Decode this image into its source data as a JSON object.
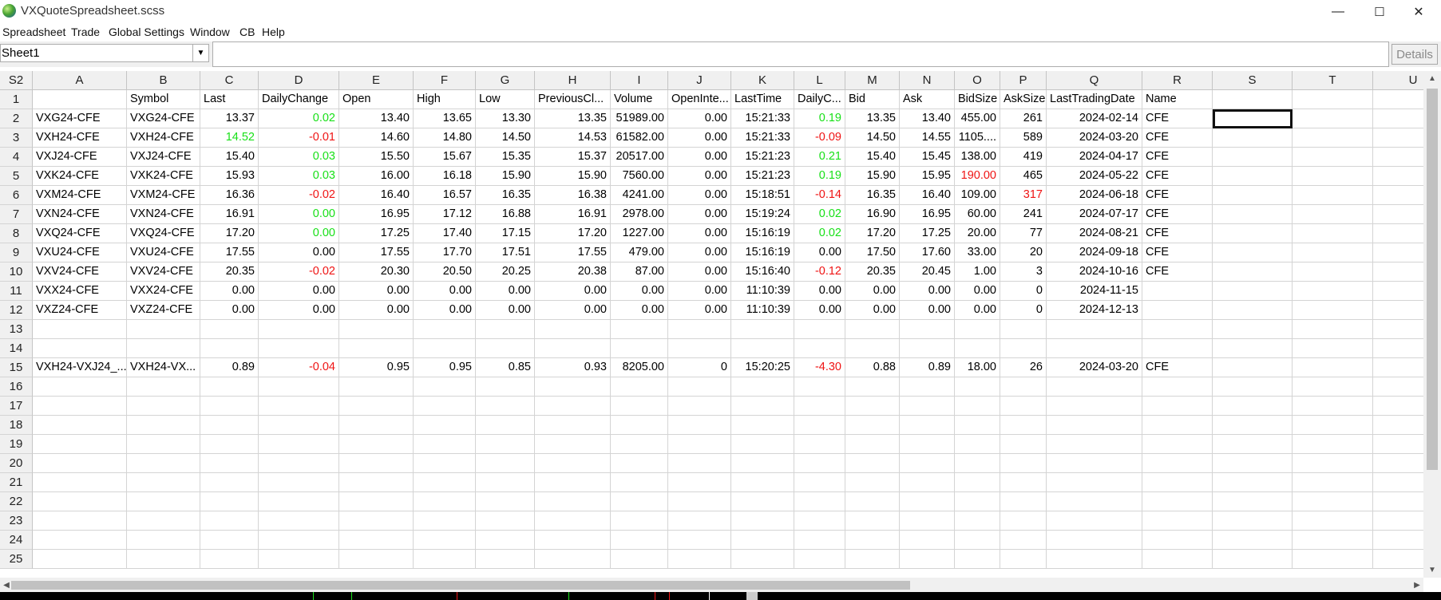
{
  "window": {
    "title": "VXQuoteSpreadsheet.scss",
    "minimize": "—",
    "maximize": "☐",
    "close": "✕"
  },
  "menu": [
    "Spreadsheet",
    "Trade",
    "Global Settings",
    "Window",
    "CB",
    "Help"
  ],
  "toolbar": {
    "sheet_selected": "Sheet1",
    "formula_value": "",
    "details_label": "Details"
  },
  "grid": {
    "corner": "S2",
    "columns": [
      "A",
      "B",
      "C",
      "D",
      "E",
      "F",
      "G",
      "H",
      "I",
      "J",
      "K",
      "L",
      "M",
      "N",
      "O",
      "P",
      "Q",
      "R",
      "S",
      "T",
      "U"
    ],
    "row_numbers": [
      "1",
      "2",
      "3",
      "4",
      "5",
      "6",
      "7",
      "8",
      "9",
      "10",
      "11",
      "12",
      "13",
      "14",
      "15",
      "16",
      "17",
      "18",
      "19",
      "20",
      "21",
      "22",
      "23",
      "24",
      "25"
    ],
    "rows": [
      [
        "",
        "Symbol",
        "Last",
        "DailyChange",
        "Open",
        "High",
        "Low",
        "PreviousCl...",
        "Volume",
        "OpenInte...",
        "LastTime",
        "DailyC...",
        "Bid",
        "Ask",
        "BidSize",
        "AskSize",
        "LastTradingDate",
        "Name",
        "",
        "",
        ""
      ],
      [
        "VXG24-CFE",
        "VXG24-CFE",
        "13.37",
        "0.02",
        "13.40",
        "13.65",
        "13.30",
        "13.35",
        "51989.00",
        "0.00",
        "15:21:33",
        "0.19",
        "13.35",
        "13.40",
        "455.00",
        "261",
        "2024-02-14",
        "CFE",
        "",
        "",
        ""
      ],
      [
        "VXH24-CFE",
        "VXH24-CFE",
        "14.52",
        "-0.01",
        "14.60",
        "14.80",
        "14.50",
        "14.53",
        "61582.00",
        "0.00",
        "15:21:33",
        "-0.09",
        "14.50",
        "14.55",
        "1105....",
        "589",
        "2024-03-20",
        "CFE",
        "",
        "",
        ""
      ],
      [
        "VXJ24-CFE",
        "VXJ24-CFE",
        "15.40",
        "0.03",
        "15.50",
        "15.67",
        "15.35",
        "15.37",
        "20517.00",
        "0.00",
        "15:21:23",
        "0.21",
        "15.40",
        "15.45",
        "138.00",
        "419",
        "2024-04-17",
        "CFE",
        "",
        "",
        ""
      ],
      [
        "VXK24-CFE",
        "VXK24-CFE",
        "15.93",
        "0.03",
        "16.00",
        "16.18",
        "15.90",
        "15.90",
        "7560.00",
        "0.00",
        "15:21:23",
        "0.19",
        "15.90",
        "15.95",
        "190.00",
        "465",
        "2024-05-22",
        "CFE",
        "",
        "",
        ""
      ],
      [
        "VXM24-CFE",
        "VXM24-CFE",
        "16.36",
        "-0.02",
        "16.40",
        "16.57",
        "16.35",
        "16.38",
        "4241.00",
        "0.00",
        "15:18:51",
        "-0.14",
        "16.35",
        "16.40",
        "109.00",
        "317",
        "2024-06-18",
        "CFE",
        "",
        "",
        ""
      ],
      [
        "VXN24-CFE",
        "VXN24-CFE",
        "16.91",
        "0.00",
        "16.95",
        "17.12",
        "16.88",
        "16.91",
        "2978.00",
        "0.00",
        "15:19:24",
        "0.02",
        "16.90",
        "16.95",
        "60.00",
        "241",
        "2024-07-17",
        "CFE",
        "",
        "",
        ""
      ],
      [
        "VXQ24-CFE",
        "VXQ24-CFE",
        "17.20",
        "0.00",
        "17.25",
        "17.40",
        "17.15",
        "17.20",
        "1227.00",
        "0.00",
        "15:16:19",
        "0.02",
        "17.20",
        "17.25",
        "20.00",
        "77",
        "2024-08-21",
        "CFE",
        "",
        "",
        ""
      ],
      [
        "VXU24-CFE",
        "VXU24-CFE",
        "17.55",
        "0.00",
        "17.55",
        "17.70",
        "17.51",
        "17.55",
        "479.00",
        "0.00",
        "15:16:19",
        "0.00",
        "17.50",
        "17.60",
        "33.00",
        "20",
        "2024-09-18",
        "CFE",
        "",
        "",
        ""
      ],
      [
        "VXV24-CFE",
        "VXV24-CFE",
        "20.35",
        "-0.02",
        "20.30",
        "20.50",
        "20.25",
        "20.38",
        "87.00",
        "0.00",
        "15:16:40",
        "-0.12",
        "20.35",
        "20.45",
        "1.00",
        "3",
        "2024-10-16",
        "CFE",
        "",
        "",
        ""
      ],
      [
        "VXX24-CFE",
        "VXX24-CFE",
        "0.00",
        "0.00",
        "0.00",
        "0.00",
        "0.00",
        "0.00",
        "0.00",
        "0.00",
        "11:10:39",
        "0.00",
        "0.00",
        "0.00",
        "0.00",
        "0",
        "2024-11-15",
        "",
        "",
        "",
        ""
      ],
      [
        "VXZ24-CFE",
        "VXZ24-CFE",
        "0.00",
        "0.00",
        "0.00",
        "0.00",
        "0.00",
        "0.00",
        "0.00",
        "0.00",
        "11:10:39",
        "0.00",
        "0.00",
        "0.00",
        "0.00",
        "0",
        "2024-12-13",
        "",
        "",
        "",
        ""
      ],
      [
        "",
        "",
        "",
        "",
        "",
        "",
        "",
        "",
        "",
        "",
        "",
        "",
        "",
        "",
        "",
        "",
        "",
        "",
        "",
        "",
        ""
      ],
      [
        "",
        "",
        "",
        "",
        "",
        "",
        "",
        "",
        "",
        "",
        "",
        "",
        "",
        "",
        "",
        "",
        "",
        "",
        "",
        "",
        ""
      ],
      [
        "VXH24-VXJ24_...",
        "VXH24-VX...",
        "0.89",
        "-0.04",
        "0.95",
        "0.95",
        "0.85",
        "0.93",
        "8205.00",
        "0",
        "15:20:25",
        "-4.30",
        "0.88",
        "0.89",
        "18.00",
        "26",
        "2024-03-20",
        "CFE",
        "",
        "",
        ""
      ]
    ],
    "text_colors": {
      "positive": "#18e018",
      "negative": "#ef1414"
    },
    "colored_cells": [
      {
        "row": 1,
        "col": 3,
        "tone": "positive"
      },
      {
        "row": 1,
        "col": 11,
        "tone": "positive"
      },
      {
        "row": 2,
        "col": 2,
        "tone": "positive"
      },
      {
        "row": 2,
        "col": 3,
        "tone": "negative"
      },
      {
        "row": 2,
        "col": 11,
        "tone": "negative"
      },
      {
        "row": 3,
        "col": 3,
        "tone": "positive"
      },
      {
        "row": 3,
        "col": 11,
        "tone": "positive"
      },
      {
        "row": 4,
        "col": 3,
        "tone": "positive"
      },
      {
        "row": 4,
        "col": 11,
        "tone": "positive"
      },
      {
        "row": 4,
        "col": 14,
        "tone": "negative"
      },
      {
        "row": 5,
        "col": 3,
        "tone": "negative"
      },
      {
        "row": 5,
        "col": 11,
        "tone": "negative"
      },
      {
        "row": 5,
        "col": 15,
        "tone": "negative"
      },
      {
        "row": 6,
        "col": 3,
        "tone": "positive"
      },
      {
        "row": 6,
        "col": 11,
        "tone": "positive"
      },
      {
        "row": 7,
        "col": 3,
        "tone": "positive"
      },
      {
        "row": 7,
        "col": 11,
        "tone": "positive"
      },
      {
        "row": 9,
        "col": 3,
        "tone": "negative"
      },
      {
        "row": 9,
        "col": 11,
        "tone": "negative"
      },
      {
        "row": 14,
        "col": 3,
        "tone": "negative"
      },
      {
        "row": 14,
        "col": 11,
        "tone": "negative"
      }
    ],
    "selected_cell": "S2"
  }
}
